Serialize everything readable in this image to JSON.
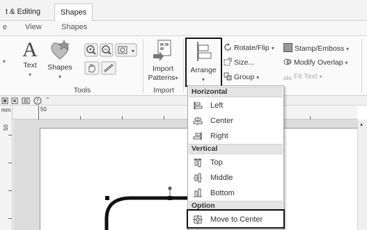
{
  "top_tabs": [
    {
      "label": "t & Editing",
      "active": false
    },
    {
      "label": "Shapes",
      "active": true
    }
  ],
  "sub_tabs": [
    {
      "label": "e"
    },
    {
      "label": "View"
    },
    {
      "label": "Shapes"
    }
  ],
  "ribbon": {
    "tools_group": {
      "text_label": "Text",
      "shapes_label": "Shapes",
      "group_label": "Tools"
    },
    "import_group": {
      "import_label_line1": "Import",
      "import_label_line2": "Patterns",
      "group_label": "Import"
    },
    "arrange_label": "Arrange",
    "small_buttons": {
      "rotate_flip": "Rotate/Flip",
      "size": "Size...",
      "group": "Group",
      "stamp_emboss": "Stamp/Emboss",
      "modify_overlap": "Modify Overlap",
      "fit_text": "Fit Text"
    }
  },
  "ruler": {
    "unit": "mm",
    "top_tick": "50",
    "left_tick": "50"
  },
  "arrange_menu": {
    "horizontal_header": "Horizontal",
    "vertical_header": "Vertical",
    "option_header": "Option",
    "horizontal_items": [
      {
        "label": "Left",
        "icon": "align-left-icon"
      },
      {
        "label": "Center",
        "icon": "align-center-icon"
      },
      {
        "label": "Right",
        "icon": "align-right-icon"
      }
    ],
    "vertical_items": [
      {
        "label": "Top",
        "icon": "align-top-icon"
      },
      {
        "label": "Middle",
        "icon": "align-middle-icon"
      },
      {
        "label": "Bottom",
        "icon": "align-bottom-icon"
      }
    ],
    "option_items": [
      {
        "label": "Move to Center",
        "icon": "move-to-center-icon"
      }
    ]
  },
  "colors": {
    "highlight_border": "#111111",
    "menu_header_bg": "#e4e4e4"
  }
}
